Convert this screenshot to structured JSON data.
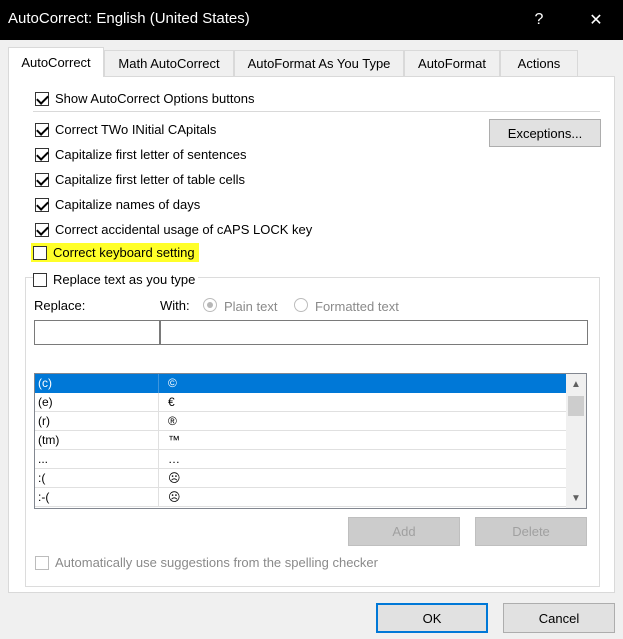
{
  "window": {
    "title": "AutoCorrect: English (United States)",
    "help_glyph": "?",
    "close_glyph": "✕"
  },
  "tabs": [
    {
      "label": "AutoCorrect",
      "active": true
    },
    {
      "label": "Math AutoCorrect"
    },
    {
      "label": "AutoFormat As You Type"
    },
    {
      "label": "AutoFormat"
    },
    {
      "label": "Actions"
    }
  ],
  "options": {
    "show_buttons": {
      "label": "Show AutoCorrect Options buttons",
      "checked": true
    },
    "two_initials": {
      "label": "Correct TWo INitial CApitals",
      "checked": true
    },
    "sentences": {
      "label": "Capitalize first letter of sentences",
      "checked": true
    },
    "table_cells": {
      "label": "Capitalize first letter of table cells",
      "checked": true
    },
    "days": {
      "label": "Capitalize names of days",
      "checked": true
    },
    "caps_lock": {
      "label": "Correct accidental usage of cAPS LOCK key",
      "checked": true
    },
    "keyboard": {
      "label": "Correct keyboard setting",
      "checked": false,
      "highlight_color": "#ffff29"
    },
    "replace_text": {
      "label": "Replace text as you type",
      "checked": false
    }
  },
  "exceptions_button": "Exceptions...",
  "replace": {
    "replace_label": "Replace:",
    "with_label": "With:",
    "plain_text": "Plain text",
    "formatted_text": "Formatted text",
    "replace_value": "",
    "with_value": ""
  },
  "entries": [
    {
      "replace": "(c)",
      "with": "©",
      "selected": true
    },
    {
      "replace": "(e)",
      "with": "€"
    },
    {
      "replace": "(r)",
      "with": "®"
    },
    {
      "replace": "(tm)",
      "with": "™"
    },
    {
      "replace": "...",
      "with": "…"
    },
    {
      "replace": ":(",
      "with": "☹"
    },
    {
      "replace": ":-(",
      "with": "☹"
    }
  ],
  "buttons": {
    "add": "Add",
    "delete": "Delete",
    "ok": "OK",
    "cancel": "Cancel"
  },
  "spelling_suggestions": {
    "label": "Automatically use suggestions from the spelling checker",
    "checked": false,
    "enabled": false
  },
  "colors": {
    "selection": "#0078d7",
    "titlebar": "#000000",
    "highlight": "#ffff29"
  }
}
